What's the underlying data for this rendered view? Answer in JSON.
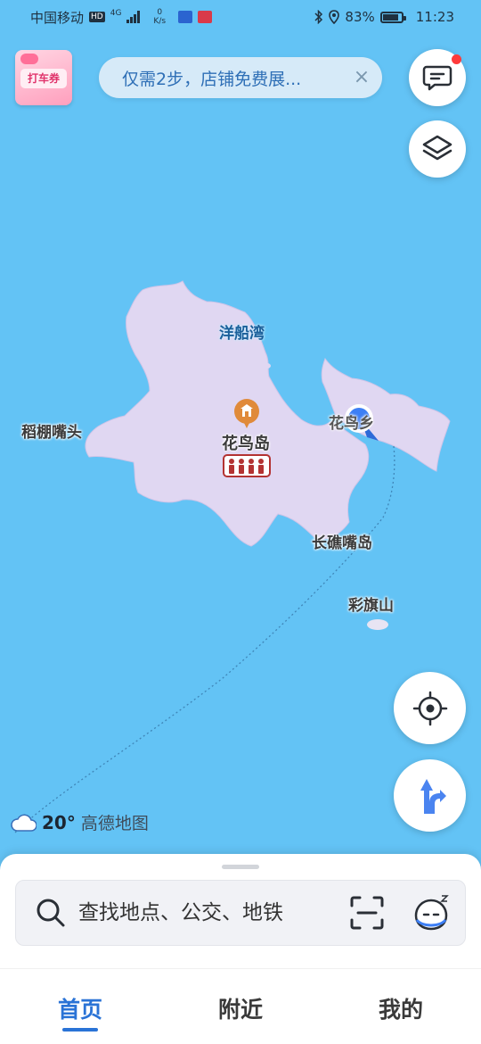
{
  "status_bar": {
    "carrier": "中国移动",
    "hd": "HD",
    "network": "4G",
    "speed_value": "0",
    "speed_unit": "K/s",
    "battery": "83%",
    "time": "11:23"
  },
  "top": {
    "coupon_label": "打车券",
    "banner_text": "仅需2步，店铺免费展...",
    "banner_close": "×"
  },
  "map": {
    "labels": {
      "yangchuanwan": "洋船湾",
      "daopengzuitou": "稻棚嘴头",
      "huaniaodao": "花鸟岛",
      "huaniaoxiang": "花鸟乡",
      "changjiaozuidao": "长礁嘴岛",
      "caiqishan": "彩旗山"
    },
    "colors": {
      "water": "#63c3f5",
      "land": "#e0d7f2",
      "location": "#3d7ff5"
    }
  },
  "weather": {
    "temp": "20°",
    "brand": "高德地图",
    "icon": "cloud-icon"
  },
  "search": {
    "placeholder": "查找地点、公交、地铁"
  },
  "tabs": [
    {
      "label": "首页",
      "active": true
    },
    {
      "label": "附近",
      "active": false
    },
    {
      "label": "我的",
      "active": false
    }
  ]
}
